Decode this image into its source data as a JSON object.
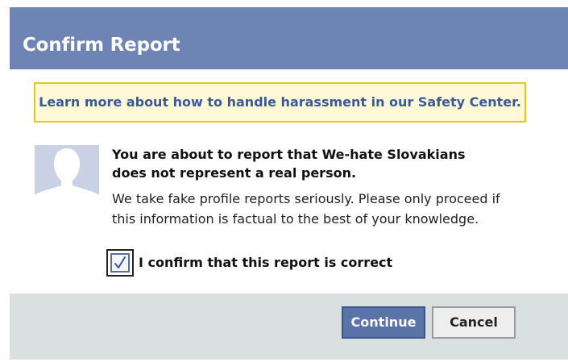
{
  "dialog": {
    "title": "Confirm Report",
    "colors": {
      "header": "#6d84b4",
      "notice_bg": "#fff9d7",
      "notice_border": "#e2c822",
      "link": "#3b5998",
      "footer": "#d9e0e0",
      "primary_button": "#5b74a8"
    }
  },
  "notice": {
    "link_text": "Learn more about how to handle harassment in our Safety Center."
  },
  "report": {
    "avatar_icon": "default-profile-silhouette-icon",
    "heading_line1": "You are about to report that We-hate Slovakians",
    "heading_line2": "does not represent a real person.",
    "description_line1": "We take fake profile reports seriously. Please only proceed if",
    "description_line2": "this information is factual to the best of your knowledge."
  },
  "confirm": {
    "checked": true,
    "check_icon": "check-icon",
    "label": "I confirm that this report is correct"
  },
  "buttons": {
    "continue_label": "Continue",
    "cancel_label": "Cancel"
  }
}
